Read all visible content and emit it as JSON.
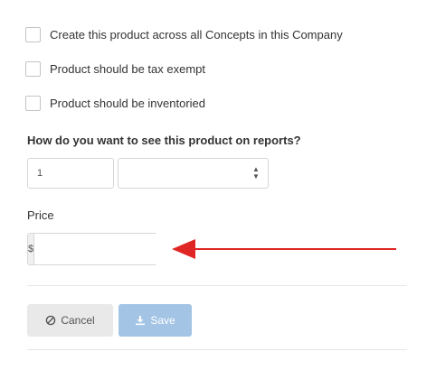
{
  "options": [
    {
      "label": "Create this product across all Concepts in this Company",
      "checked": false
    },
    {
      "label": "Product should be tax exempt",
      "checked": false
    },
    {
      "label": "Product should be inventoried",
      "checked": false
    }
  ],
  "reporting": {
    "question": "How do you want to see this product on reports?",
    "quantity_value": "1",
    "unit_selected": ""
  },
  "price": {
    "label": "Price",
    "currency_symbol": "$",
    "value": ""
  },
  "actions": {
    "cancel_label": "Cancel",
    "save_label": "Save"
  },
  "colors": {
    "annotation_arrow": "#e02525",
    "save_button": "#a3c4e4",
    "cancel_button": "#e9e9e9"
  },
  "icons": {
    "cancel": "ban-icon",
    "save": "download-icon",
    "select": "sort-caret-icon"
  }
}
